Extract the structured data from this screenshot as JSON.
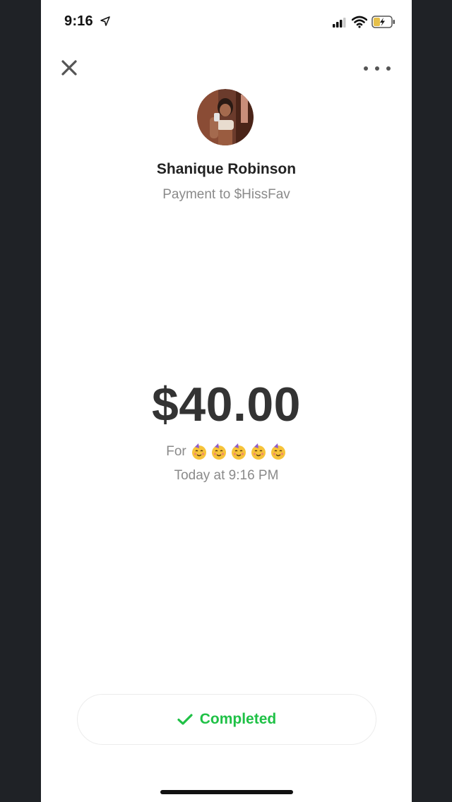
{
  "status_bar": {
    "time": "9:16"
  },
  "payment": {
    "recipient_name": "Shanique Robinson",
    "payment_to": "Payment to $HissFav",
    "amount": "$40.00",
    "for_label": "For",
    "note_emojis": [
      "partying-face",
      "partying-face",
      "partying-face",
      "partying-face",
      "partying-face"
    ],
    "timestamp": "Today at 9:16 PM",
    "status": "Completed"
  },
  "colors": {
    "status_green": "#1fc146",
    "amount_text": "#333333",
    "muted_text": "#8a8a8a",
    "frame_background": "#1f2226"
  },
  "icons": {
    "close": "close-icon",
    "more": "more-icon",
    "check": "check-icon",
    "location": "location-arrow-icon",
    "signal": "signal-icon",
    "wifi": "wifi-icon",
    "battery": "battery-charging-icon"
  }
}
